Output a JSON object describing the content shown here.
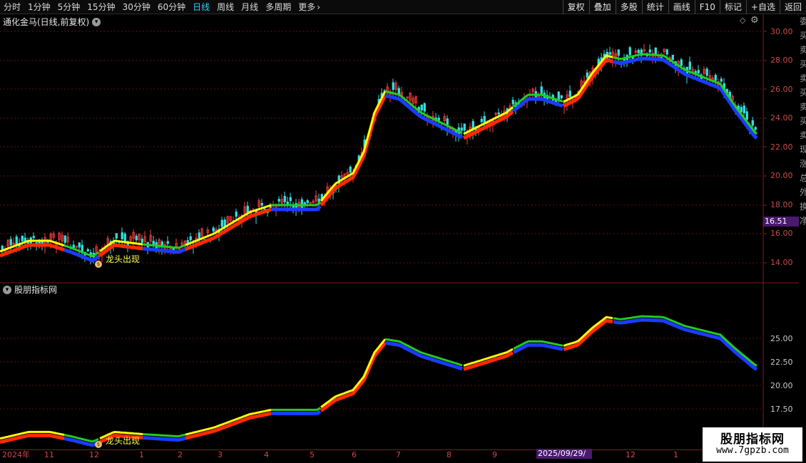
{
  "toolbar": {
    "periods": [
      "分时",
      "1分钟",
      "5分钟",
      "15分钟",
      "30分钟",
      "60分钟",
      "日线",
      "周线",
      "月线",
      "多周期",
      "更多"
    ],
    "active_period": "日线",
    "more_icon": "chevron-right-icon",
    "right_buttons": [
      "复权",
      "叠加",
      "多股",
      "统计",
      "画线",
      "F10",
      "标记",
      "+自选",
      "返回"
    ]
  },
  "main_chart": {
    "title": "通化金马(日线,前复权)",
    "price_ticks": [
      "30.00",
      "28.00",
      "26.00",
      "24.00",
      "22.00",
      "20.00",
      "18.00",
      "16.00",
      "14.00"
    ],
    "current_price": "16.51",
    "signal_label": "龙头出现",
    "signal_icon": "money-bag-icon",
    "colors": {
      "up": "#ff3b3b",
      "down": "#33e0e0",
      "yellow": "#ffff00",
      "red": "#ff2a00",
      "blue": "#1a3cff",
      "green": "#22cc22"
    }
  },
  "sub_chart": {
    "title": "股朋指标网",
    "ticks": [
      "25.00",
      "22.50",
      "20.00",
      "17.50"
    ],
    "signal_label": "龙头出现"
  },
  "date_axis": {
    "labels": [
      "2024年",
      "11",
      "12",
      "1",
      "2",
      "3",
      "4",
      "5",
      "6",
      "7",
      "8",
      "9",
      "12",
      "1"
    ],
    "cursor_date": "2025/09/29/—"
  },
  "side_strip": [
    "委",
    "买",
    "卖",
    "买",
    "卖",
    "买",
    "卖",
    "买",
    "卖",
    "现",
    "涨",
    "总",
    "外",
    "换",
    "净"
  ],
  "watermark": {
    "title": "股朋指标网",
    "url": "www.7gpzb.com"
  }
}
